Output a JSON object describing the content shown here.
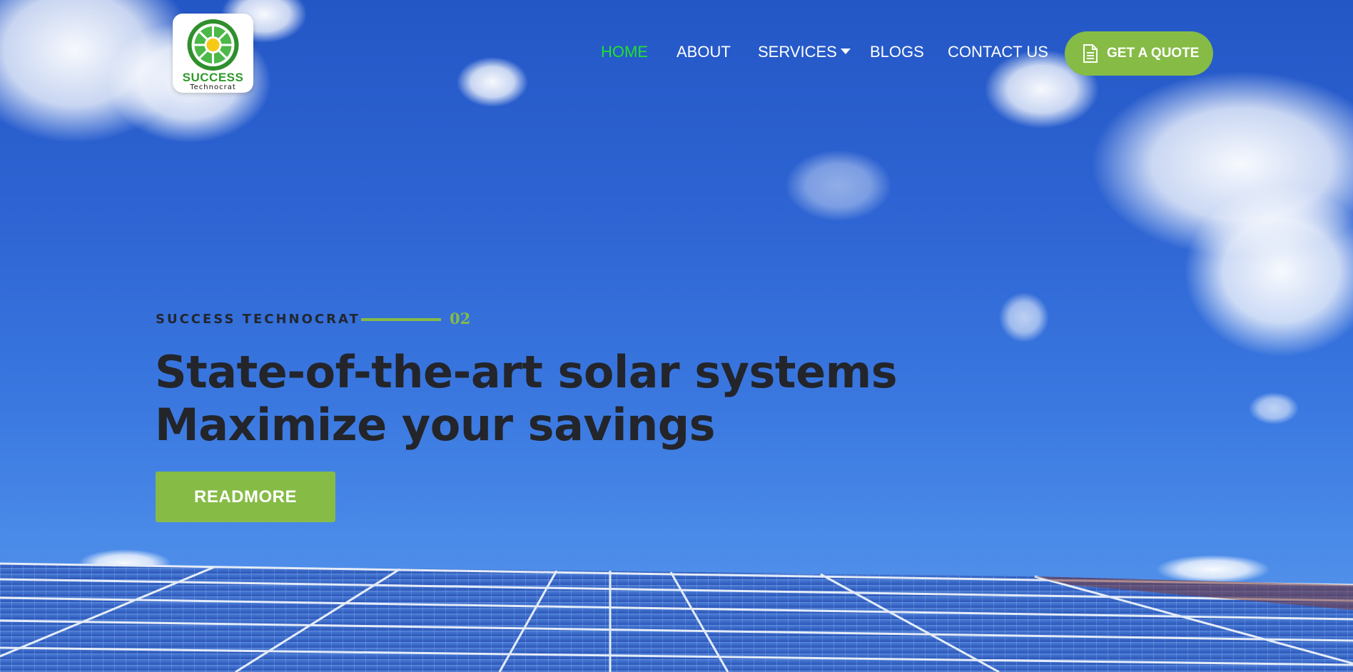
{
  "logo": {
    "brand": "SUCCESS",
    "subtitle": "Technocrat"
  },
  "nav": {
    "items": [
      {
        "label": "HOME",
        "active": true
      },
      {
        "label": "ABOUT",
        "active": false
      },
      {
        "label": "SERVICES",
        "active": false,
        "has_dropdown": true
      },
      {
        "label": "BLOGS",
        "active": false
      },
      {
        "label": "CONTACT US",
        "active": false
      }
    ],
    "cta_label": "GET A QUOTE",
    "cta_icon": "document-icon"
  },
  "hero": {
    "eyebrow": "SUCCESS TECHNOCRAT",
    "slide_number": "02",
    "headline_line1": "State-of-the-art solar systems",
    "headline_line2": "Maximize your savings",
    "button_label": "READMORE"
  },
  "colors": {
    "accent_green": "#86bb46",
    "active_nav": "#1fe22e",
    "headline": "#23252b",
    "sky": "#2d63d2"
  }
}
